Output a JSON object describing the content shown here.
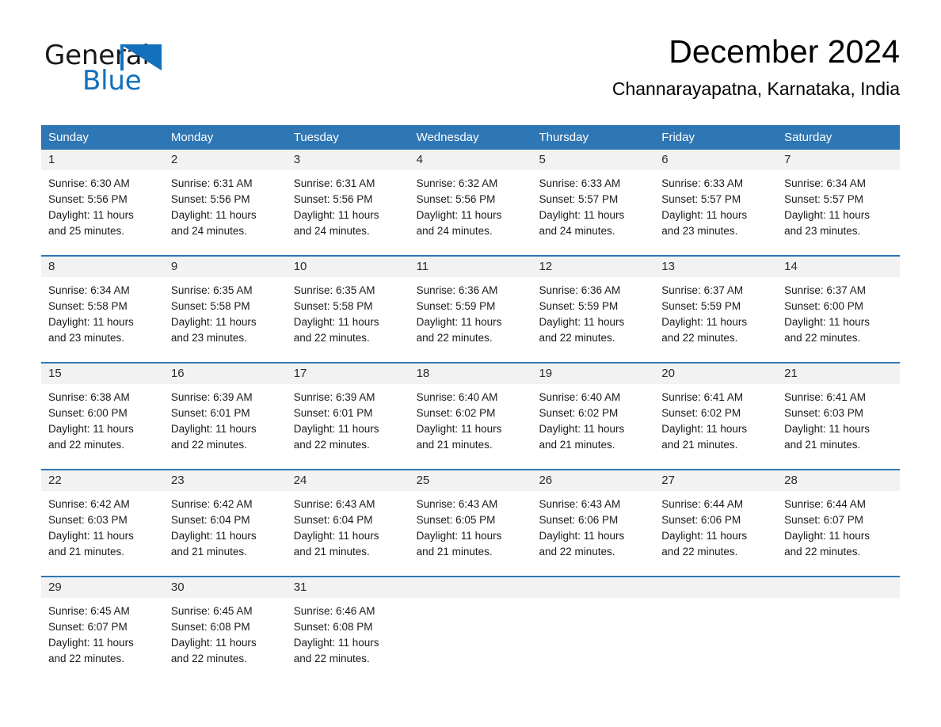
{
  "brand": {
    "name_part1": "General",
    "name_part2": "Blue",
    "triangle_color": "#1270bd"
  },
  "header": {
    "title": "December 2024",
    "subtitle": "Channarayapatna, Karnataka, India"
  },
  "theme": {
    "header_blue": "#2f76b4",
    "day_band_gray": "#f2f2f2",
    "text_color": "#1a1a1a"
  },
  "weekdays": [
    "Sunday",
    "Monday",
    "Tuesday",
    "Wednesday",
    "Thursday",
    "Friday",
    "Saturday"
  ],
  "weeks": [
    [
      {
        "day": "1",
        "sunrise": "Sunrise: 6:30 AM",
        "sunset": "Sunset: 5:56 PM",
        "daylight_line1": "Daylight: 11 hours",
        "daylight_line2": "and 25 minutes."
      },
      {
        "day": "2",
        "sunrise": "Sunrise: 6:31 AM",
        "sunset": "Sunset: 5:56 PM",
        "daylight_line1": "Daylight: 11 hours",
        "daylight_line2": "and 24 minutes."
      },
      {
        "day": "3",
        "sunrise": "Sunrise: 6:31 AM",
        "sunset": "Sunset: 5:56 PM",
        "daylight_line1": "Daylight: 11 hours",
        "daylight_line2": "and 24 minutes."
      },
      {
        "day": "4",
        "sunrise": "Sunrise: 6:32 AM",
        "sunset": "Sunset: 5:56 PM",
        "daylight_line1": "Daylight: 11 hours",
        "daylight_line2": "and 24 minutes."
      },
      {
        "day": "5",
        "sunrise": "Sunrise: 6:33 AM",
        "sunset": "Sunset: 5:57 PM",
        "daylight_line1": "Daylight: 11 hours",
        "daylight_line2": "and 24 minutes."
      },
      {
        "day": "6",
        "sunrise": "Sunrise: 6:33 AM",
        "sunset": "Sunset: 5:57 PM",
        "daylight_line1": "Daylight: 11 hours",
        "daylight_line2": "and 23 minutes."
      },
      {
        "day": "7",
        "sunrise": "Sunrise: 6:34 AM",
        "sunset": "Sunset: 5:57 PM",
        "daylight_line1": "Daylight: 11 hours",
        "daylight_line2": "and 23 minutes."
      }
    ],
    [
      {
        "day": "8",
        "sunrise": "Sunrise: 6:34 AM",
        "sunset": "Sunset: 5:58 PM",
        "daylight_line1": "Daylight: 11 hours",
        "daylight_line2": "and 23 minutes."
      },
      {
        "day": "9",
        "sunrise": "Sunrise: 6:35 AM",
        "sunset": "Sunset: 5:58 PM",
        "daylight_line1": "Daylight: 11 hours",
        "daylight_line2": "and 23 minutes."
      },
      {
        "day": "10",
        "sunrise": "Sunrise: 6:35 AM",
        "sunset": "Sunset: 5:58 PM",
        "daylight_line1": "Daylight: 11 hours",
        "daylight_line2": "and 22 minutes."
      },
      {
        "day": "11",
        "sunrise": "Sunrise: 6:36 AM",
        "sunset": "Sunset: 5:59 PM",
        "daylight_line1": "Daylight: 11 hours",
        "daylight_line2": "and 22 minutes."
      },
      {
        "day": "12",
        "sunrise": "Sunrise: 6:36 AM",
        "sunset": "Sunset: 5:59 PM",
        "daylight_line1": "Daylight: 11 hours",
        "daylight_line2": "and 22 minutes."
      },
      {
        "day": "13",
        "sunrise": "Sunrise: 6:37 AM",
        "sunset": "Sunset: 5:59 PM",
        "daylight_line1": "Daylight: 11 hours",
        "daylight_line2": "and 22 minutes."
      },
      {
        "day": "14",
        "sunrise": "Sunrise: 6:37 AM",
        "sunset": "Sunset: 6:00 PM",
        "daylight_line1": "Daylight: 11 hours",
        "daylight_line2": "and 22 minutes."
      }
    ],
    [
      {
        "day": "15",
        "sunrise": "Sunrise: 6:38 AM",
        "sunset": "Sunset: 6:00 PM",
        "daylight_line1": "Daylight: 11 hours",
        "daylight_line2": "and 22 minutes."
      },
      {
        "day": "16",
        "sunrise": "Sunrise: 6:39 AM",
        "sunset": "Sunset: 6:01 PM",
        "daylight_line1": "Daylight: 11 hours",
        "daylight_line2": "and 22 minutes."
      },
      {
        "day": "17",
        "sunrise": "Sunrise: 6:39 AM",
        "sunset": "Sunset: 6:01 PM",
        "daylight_line1": "Daylight: 11 hours",
        "daylight_line2": "and 22 minutes."
      },
      {
        "day": "18",
        "sunrise": "Sunrise: 6:40 AM",
        "sunset": "Sunset: 6:02 PM",
        "daylight_line1": "Daylight: 11 hours",
        "daylight_line2": "and 21 minutes."
      },
      {
        "day": "19",
        "sunrise": "Sunrise: 6:40 AM",
        "sunset": "Sunset: 6:02 PM",
        "daylight_line1": "Daylight: 11 hours",
        "daylight_line2": "and 21 minutes."
      },
      {
        "day": "20",
        "sunrise": "Sunrise: 6:41 AM",
        "sunset": "Sunset: 6:02 PM",
        "daylight_line1": "Daylight: 11 hours",
        "daylight_line2": "and 21 minutes."
      },
      {
        "day": "21",
        "sunrise": "Sunrise: 6:41 AM",
        "sunset": "Sunset: 6:03 PM",
        "daylight_line1": "Daylight: 11 hours",
        "daylight_line2": "and 21 minutes."
      }
    ],
    [
      {
        "day": "22",
        "sunrise": "Sunrise: 6:42 AM",
        "sunset": "Sunset: 6:03 PM",
        "daylight_line1": "Daylight: 11 hours",
        "daylight_line2": "and 21 minutes."
      },
      {
        "day": "23",
        "sunrise": "Sunrise: 6:42 AM",
        "sunset": "Sunset: 6:04 PM",
        "daylight_line1": "Daylight: 11 hours",
        "daylight_line2": "and 21 minutes."
      },
      {
        "day": "24",
        "sunrise": "Sunrise: 6:43 AM",
        "sunset": "Sunset: 6:04 PM",
        "daylight_line1": "Daylight: 11 hours",
        "daylight_line2": "and 21 minutes."
      },
      {
        "day": "25",
        "sunrise": "Sunrise: 6:43 AM",
        "sunset": "Sunset: 6:05 PM",
        "daylight_line1": "Daylight: 11 hours",
        "daylight_line2": "and 21 minutes."
      },
      {
        "day": "26",
        "sunrise": "Sunrise: 6:43 AM",
        "sunset": "Sunset: 6:06 PM",
        "daylight_line1": "Daylight: 11 hours",
        "daylight_line2": "and 22 minutes."
      },
      {
        "day": "27",
        "sunrise": "Sunrise: 6:44 AM",
        "sunset": "Sunset: 6:06 PM",
        "daylight_line1": "Daylight: 11 hours",
        "daylight_line2": "and 22 minutes."
      },
      {
        "day": "28",
        "sunrise": "Sunrise: 6:44 AM",
        "sunset": "Sunset: 6:07 PM",
        "daylight_line1": "Daylight: 11 hours",
        "daylight_line2": "and 22 minutes."
      }
    ],
    [
      {
        "day": "29",
        "sunrise": "Sunrise: 6:45 AM",
        "sunset": "Sunset: 6:07 PM",
        "daylight_line1": "Daylight: 11 hours",
        "daylight_line2": "and 22 minutes."
      },
      {
        "day": "30",
        "sunrise": "Sunrise: 6:45 AM",
        "sunset": "Sunset: 6:08 PM",
        "daylight_line1": "Daylight: 11 hours",
        "daylight_line2": "and 22 minutes."
      },
      {
        "day": "31",
        "sunrise": "Sunrise: 6:46 AM",
        "sunset": "Sunset: 6:08 PM",
        "daylight_line1": "Daylight: 11 hours",
        "daylight_line2": "and 22 minutes."
      },
      {
        "day": "",
        "sunrise": "",
        "sunset": "",
        "daylight_line1": "",
        "daylight_line2": ""
      },
      {
        "day": "",
        "sunrise": "",
        "sunset": "",
        "daylight_line1": "",
        "daylight_line2": ""
      },
      {
        "day": "",
        "sunrise": "",
        "sunset": "",
        "daylight_line1": "",
        "daylight_line2": ""
      },
      {
        "day": "",
        "sunrise": "",
        "sunset": "",
        "daylight_line1": "",
        "daylight_line2": ""
      }
    ]
  ]
}
